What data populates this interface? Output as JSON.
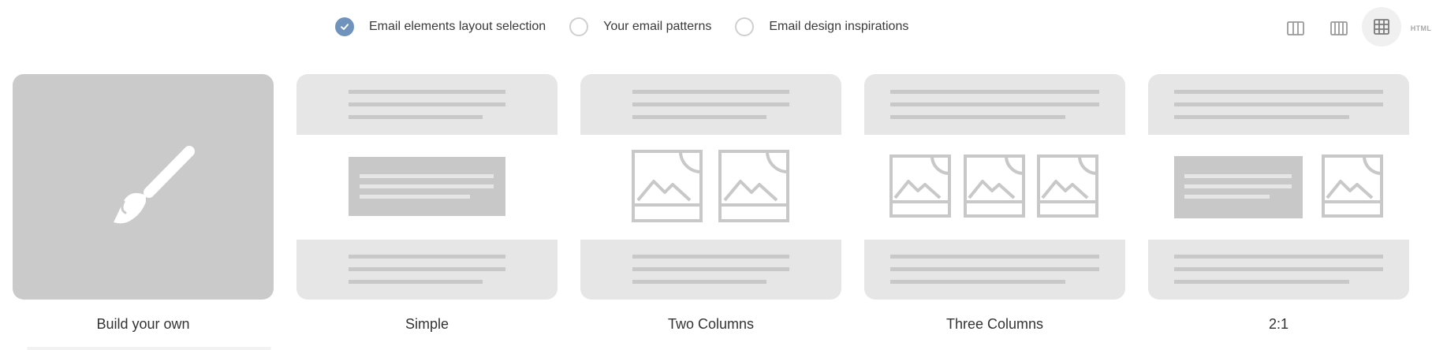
{
  "layout_options": [
    {
      "label": "Email elements layout selection",
      "checked": true
    },
    {
      "label": "Your email patterns",
      "checked": false
    },
    {
      "label": "Email design inspirations",
      "checked": false
    }
  ],
  "view_switch": {
    "buttons": [
      "two-column-view-icon",
      "three-column-view-icon",
      "grid-view-icon",
      "html-view"
    ],
    "active": "grid-view-icon",
    "html_label": "HTML"
  },
  "templates": [
    {
      "name": "Build your own",
      "icon": "paintbrush-icon"
    },
    {
      "name": "Simple"
    },
    {
      "name": "Two Columns"
    },
    {
      "name": "Three Columns"
    },
    {
      "name": "2:1"
    }
  ],
  "colors": {
    "accent": "#6f93bd",
    "card_bg": "#e6e6e6",
    "build_card_bg": "#cacaca",
    "placeholder": "#c8c8c8"
  }
}
